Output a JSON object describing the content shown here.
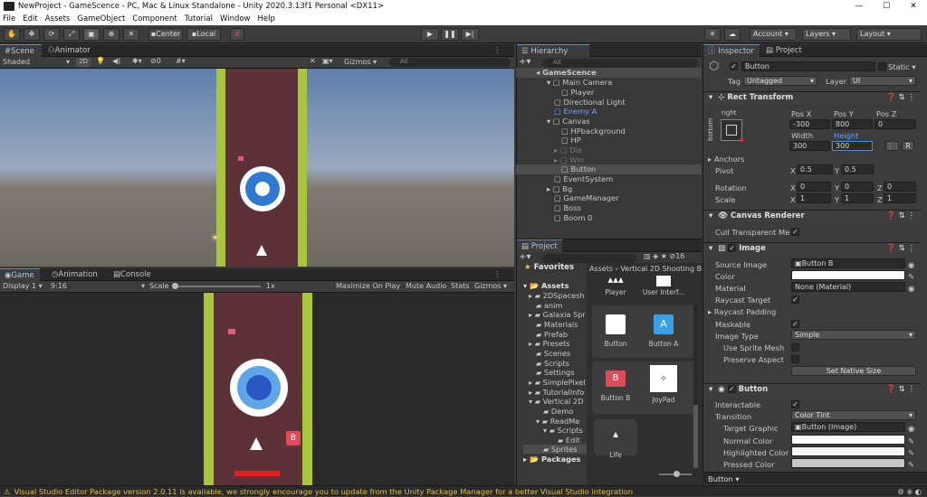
{
  "window": {
    "title": "NewProject - GameScence - PC, Mac & Linux Standalone - Unity 2020.3.13f1 Personal <DX11>",
    "controls": [
      "—",
      "☐",
      "✕"
    ]
  },
  "menu": [
    "File",
    "Edit",
    "Assets",
    "GameObject",
    "Component",
    "Tutorial",
    "Window",
    "Help"
  ],
  "toolbar": {
    "center": "Center",
    "local": "Local",
    "account": "Account",
    "layers": "Layers",
    "layout": "Layout"
  },
  "scene": {
    "tabs": [
      "Scene",
      "Animator"
    ],
    "shading": "Shaded",
    "mode2d": "2D",
    "gizmo_count": "0",
    "gizmos": "Gizmos",
    "search": "All"
  },
  "game": {
    "tabs": [
      "Game",
      "Animation",
      "Console"
    ],
    "display": "Display 1",
    "aspect": "9:16",
    "scale_label": "Scale",
    "scale_value": "1x",
    "maximize": "Maximize On Play",
    "mute": "Mute Audio",
    "stats": "Stats",
    "gizmos": "Gizmos"
  },
  "hierarchy": {
    "tab": "Hierarchy",
    "search": "All",
    "items": [
      {
        "label": "GameScence"
      },
      {
        "label": "Main Camera"
      },
      {
        "label": "Player"
      },
      {
        "label": "Directional Light"
      },
      {
        "label": "Enemy A"
      },
      {
        "label": "Canvas"
      },
      {
        "label": "HPbackground"
      },
      {
        "label": "HP"
      },
      {
        "label": "Die"
      },
      {
        "label": "Win"
      },
      {
        "label": "Button"
      },
      {
        "label": "EventSystem"
      },
      {
        "label": "Bg"
      },
      {
        "label": "GameManager"
      },
      {
        "label": "Boss"
      },
      {
        "label": "Boom 0"
      }
    ]
  },
  "project": {
    "tab": "Project",
    "count": "16",
    "favorites": "Favorites",
    "breadcrumb": "Assets  ›  Vertical 2D Shooting B",
    "folders": [
      "Assets",
      "2DSpacesh",
      "anim",
      "Galaxia Spr",
      "Materials",
      "Prefab",
      "Presets",
      "Scenes",
      "Scripts",
      "Settings",
      "SimplePixel",
      "TutorialInfo",
      "Vertical 2D",
      "Demo",
      "ReadMe",
      "Scripts",
      "Edit",
      "Sprites",
      "Packages"
    ],
    "assets": [
      "Player",
      "User Interf...",
      "Button",
      "Button A",
      "Button B",
      "JoyPad",
      "Life"
    ]
  },
  "inspector": {
    "tabs": [
      "Inspector",
      "Project"
    ],
    "name": "Button",
    "static": "Static",
    "tag_label": "Tag",
    "tag": "Untagged",
    "layer_label": "Layer",
    "layer": "UI",
    "rect": {
      "title": "Rect Transform",
      "anchor_h": "right",
      "anchor_v": "bottom",
      "posx_l": "Pos X",
      "posy_l": "Pos Y",
      "posz_l": "Pos Z",
      "posx": "-300",
      "posy": "800",
      "posz": "0",
      "w_l": "Width",
      "h_l": "Height",
      "w": "300",
      "h": "300",
      "r": "R",
      "anchors": "Anchors",
      "pivot": "Pivot",
      "pivot_x": "0.5",
      "pivot_y": "0.5",
      "rotation": "Rotation",
      "rot_x": "0",
      "rot_y": "0",
      "rot_z": "0",
      "scale": "Scale",
      "scale_x": "1",
      "scale_y": "1",
      "scale_z": "1"
    },
    "canvas_renderer": {
      "title": "Canvas Renderer",
      "cull": "Cull Transparent Mesh"
    },
    "image": {
      "title": "Image",
      "source_label": "Source Image",
      "source": "Button B",
      "color_label": "Color",
      "material_label": "Material",
      "material": "None (Material)",
      "raycast": "Raycast Target",
      "raycast_pad": "Raycast Padding",
      "maskable": "Maskable",
      "type_label": "Image Type",
      "type": "Simple",
      "sprite_mesh": "Use Sprite Mesh",
      "preserve": "Preserve Aspect",
      "native": "Set Native Size"
    },
    "button": {
      "title": "Button",
      "interactable": "Interactable",
      "transition_label": "Transition",
      "transition": "Color Tint",
      "target_label": "Target Graphic",
      "target": "Button (Image)",
      "normal": "Normal Color",
      "highlighted": "Highlighted Color",
      "pressed": "Pressed Color"
    },
    "footer": "Button"
  },
  "status": {
    "message": "Visual Studio Editor Package version 2.0.11 is available, we strongly encourage you to update from the Unity Package Manager for a better Visual Studio integration"
  }
}
